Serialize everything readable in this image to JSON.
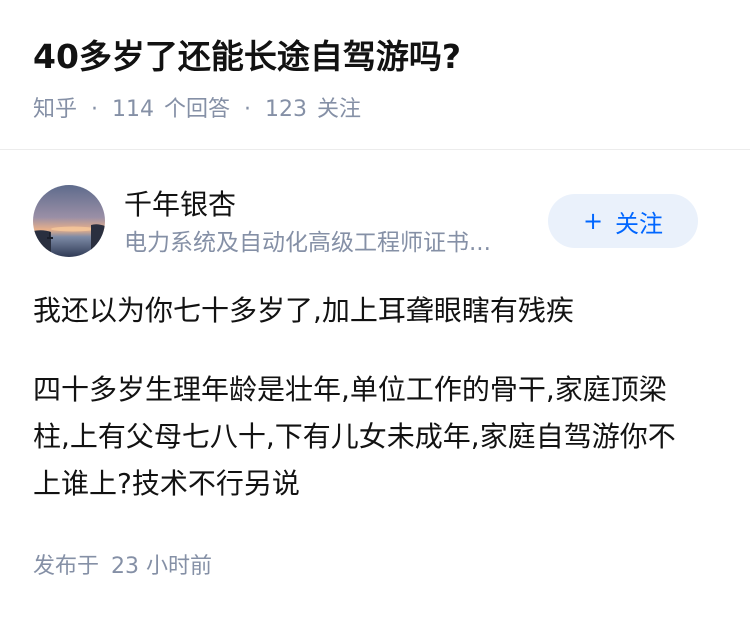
{
  "question": {
    "title": "40多岁了还能长途自驾游吗?",
    "source": "知乎",
    "answer_count": "114",
    "answer_label": "个回答",
    "follower_count": "123",
    "follower_label": "关注",
    "separator": "·"
  },
  "answer": {
    "author": {
      "name": "千年银杏",
      "headline": "电力系统及自动化高级工程师证书..."
    },
    "follow_button": {
      "icon": "plus-icon",
      "plus": "+",
      "label": "关注"
    },
    "paragraphs": [
      "我还以为你七十多岁了,加上耳聋眼瞎有残疾",
      "四十多岁生理年龄是壮年,单位工作的骨干,家庭顶梁柱,上有父母七八十,下有儿女未成年,家庭自驾游你不上谁上?技术不行另说"
    ],
    "publish": {
      "label": "发布于",
      "time": "23 小时前"
    }
  },
  "colors": {
    "accent": "#0066ff",
    "follow_bg": "#eaf1fb",
    "meta_gray": "#8590a6",
    "text": "#121212"
  }
}
